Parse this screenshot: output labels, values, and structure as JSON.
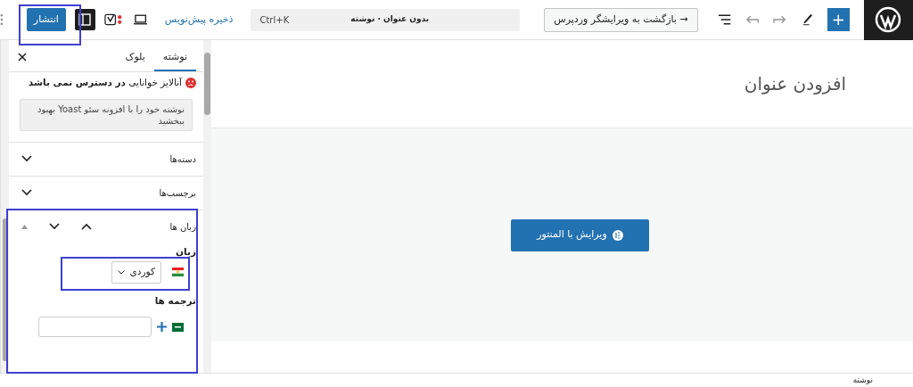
{
  "toolbar": {
    "add_label": "+",
    "back_button": "→ بازگشت به ویرایشگر وردپرس",
    "document_title": "بدون عنوان · نوشته",
    "shortcut": "Ctrl+K",
    "save_draft": "ذخیره پیش‌نویس",
    "settings_panel_open": true,
    "publish": "انتشار"
  },
  "sidebar": {
    "tabs": [
      {
        "label": "نوشته",
        "selected": true
      },
      {
        "label": "بلوک",
        "selected": false
      }
    ],
    "readability": {
      "text": "آنالایز خوانایی **در دسترس نمی باشد**"
    },
    "notice": "نوشته خود را با افزونه سئو Yoast بهبود ببخشید",
    "panels": [
      {
        "title": "دسته‌ها",
        "expanded": false
      },
      {
        "title": "برچسب‌ها",
        "expanded": false
      },
      {
        "title": "زبان ها",
        "expanded": true
      }
    ],
    "language": {
      "label": "زبان",
      "value": "کوردی"
    },
    "translations": {
      "label": "ترجمه ها"
    }
  },
  "editor": {
    "title_placeholder": "افزودن عنوان",
    "elementor_button": "ویرایش با المنتور"
  },
  "status_bar": "نوشته"
}
